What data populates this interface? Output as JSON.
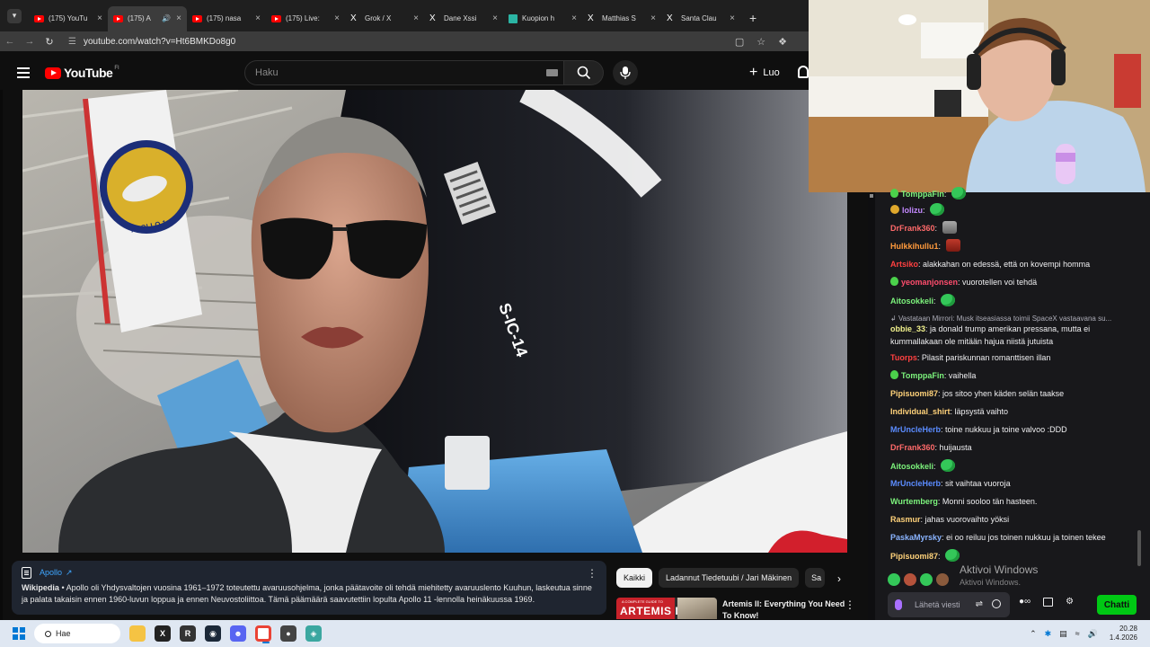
{
  "browser": {
    "tabs": [
      {
        "label": "(175) YouTu",
        "icon": "youtube-icon"
      },
      {
        "label": "(175) A",
        "icon": "youtube-icon",
        "active": true
      },
      {
        "label": "(175) nasa",
        "icon": "youtube-icon"
      },
      {
        "label": "(175) Live:",
        "icon": "youtube-icon"
      },
      {
        "label": "Grok / X",
        "icon": "x-icon"
      },
      {
        "label": "Dane Xssi",
        "icon": "x-icon"
      },
      {
        "label": "Kuopion h",
        "icon": "kuopio-icon"
      },
      {
        "label": "Matthias S",
        "icon": "x-icon"
      },
      {
        "label": "Santa Clau",
        "icon": "x-icon"
      }
    ],
    "url": "youtube.com/watch?v=Ht6BMKDo8g0"
  },
  "youtube": {
    "logo_text": "YouTube",
    "region": "FI",
    "search_placeholder": "Haku",
    "create_label": "Luo"
  },
  "info_card": {
    "title": "Apollo",
    "source": "Wikipedia",
    "text": "Apollo oli Yhdysvaltojen vuosina 1961–1972 toteutettu avaruusohjelma, jonka päätavoite oli tehdä miehitetty avaruuslento Kuuhun, laskeutua sinne ja palata takaisin ennen 1960-luvun loppua ja ennen Neuvostoliittoa. Tämä päämäärä saavutettiin lopulta Apollo 11 -lennolla heinäkuussa 1969."
  },
  "chips": [
    "Kaikki",
    "Ladannut Tiedetuubi / Jari Mäkinen",
    "Sa"
  ],
  "recommendation": {
    "thumb_small": "A COMPLETE GUIDE TO",
    "thumb_big": "ARTEMIS II",
    "title": "Artemis II: Everything You Need To Know!"
  },
  "video": {
    "stage_label": "S-IC-14",
    "patch_text": "APOLLO 1"
  },
  "chat": {
    "messages": [
      {
        "user": "TomppaFin",
        "color": "#7cf37c",
        "text": "",
        "badge": "pear",
        "emote": "green"
      },
      {
        "user": "lolizu",
        "color": "#c389ff",
        "text": "",
        "badge": "gold",
        "emote": "green"
      },
      {
        "user": "DrFrank360",
        "color": "#ff6a6a",
        "text": "",
        "emote": "cat"
      },
      {
        "user": "Hulkkihullu1",
        "color": "#ff9a3c",
        "text": "",
        "emote": "red"
      },
      {
        "user": "Artsiko",
        "color": "#ff4040",
        "text": "alakkahan on edessä, että on kovempi homma"
      },
      {
        "user": "yeomanjonsen",
        "color": "#ff4d6d",
        "text": "vuorotellen voi tehdä",
        "badge": "pear"
      },
      {
        "user": "Aitosokkeli",
        "color": "#7cf37c",
        "text": "",
        "emote": "green"
      },
      {
        "reply": "Vastataan Mirrori: Musk itseasiassa toimii SpaceX vastaavana su..."
      },
      {
        "user": "obbie_33",
        "color": "#f0f08c",
        "text": "ja donald trump amerikan pressana, mutta ei kummallakaan ole mitään hajua niistä jutuista"
      },
      {
        "user": "Tuorps",
        "color": "#ff4040",
        "text": "Pilasit pariskunnan romanttisen illan"
      },
      {
        "user": "TomppaFin",
        "color": "#7cf37c",
        "text": "vaihella",
        "badge": "pear"
      },
      {
        "user": "Pipisuomi87",
        "color": "#ffd27a",
        "text": "jos sitoo yhen käden selän taakse"
      },
      {
        "user": "Individual_shirt",
        "color": "#ffd27a",
        "text": "läpsystä vaihto"
      },
      {
        "user": "MrUncleHerb",
        "color": "#5b8cff",
        "text": "toine nukkuu ja toine valvoo :DDD"
      },
      {
        "user": "DrFrank360",
        "color": "#ff6a6a",
        "text": "huijausta"
      },
      {
        "user": "Aitosokkeli",
        "color": "#7cf37c",
        "text": "",
        "emote": "green"
      },
      {
        "user": "MrUncleHerb",
        "color": "#5b8cff",
        "text": "sit vaihtaa vuoroja"
      },
      {
        "user": "Wurtemberg",
        "color": "#7cf37c",
        "text": "Monni sooloo tän hasteen."
      },
      {
        "user": "Rasmur",
        "color": "#ffd27a",
        "text": "jahas vuorovaihto yöksi"
      },
      {
        "user": "PaskaMyrsky",
        "color": "#8ab4ff",
        "text": "ei oo reiluu jos toinen nukkuu ja toinen tekee"
      },
      {
        "user": "Pipisuomi87",
        "color": "#ffd27a",
        "text": "",
        "emote": "green"
      }
    ],
    "input_placeholder": "Lähetä viesti",
    "send_label": "Chatti"
  },
  "windows": {
    "activate_title": "Aktivoi Windows",
    "activate_sub": "Aktivoi Windows.",
    "search_label": "Hae",
    "time": "20.28",
    "date": "1.4.2026"
  }
}
